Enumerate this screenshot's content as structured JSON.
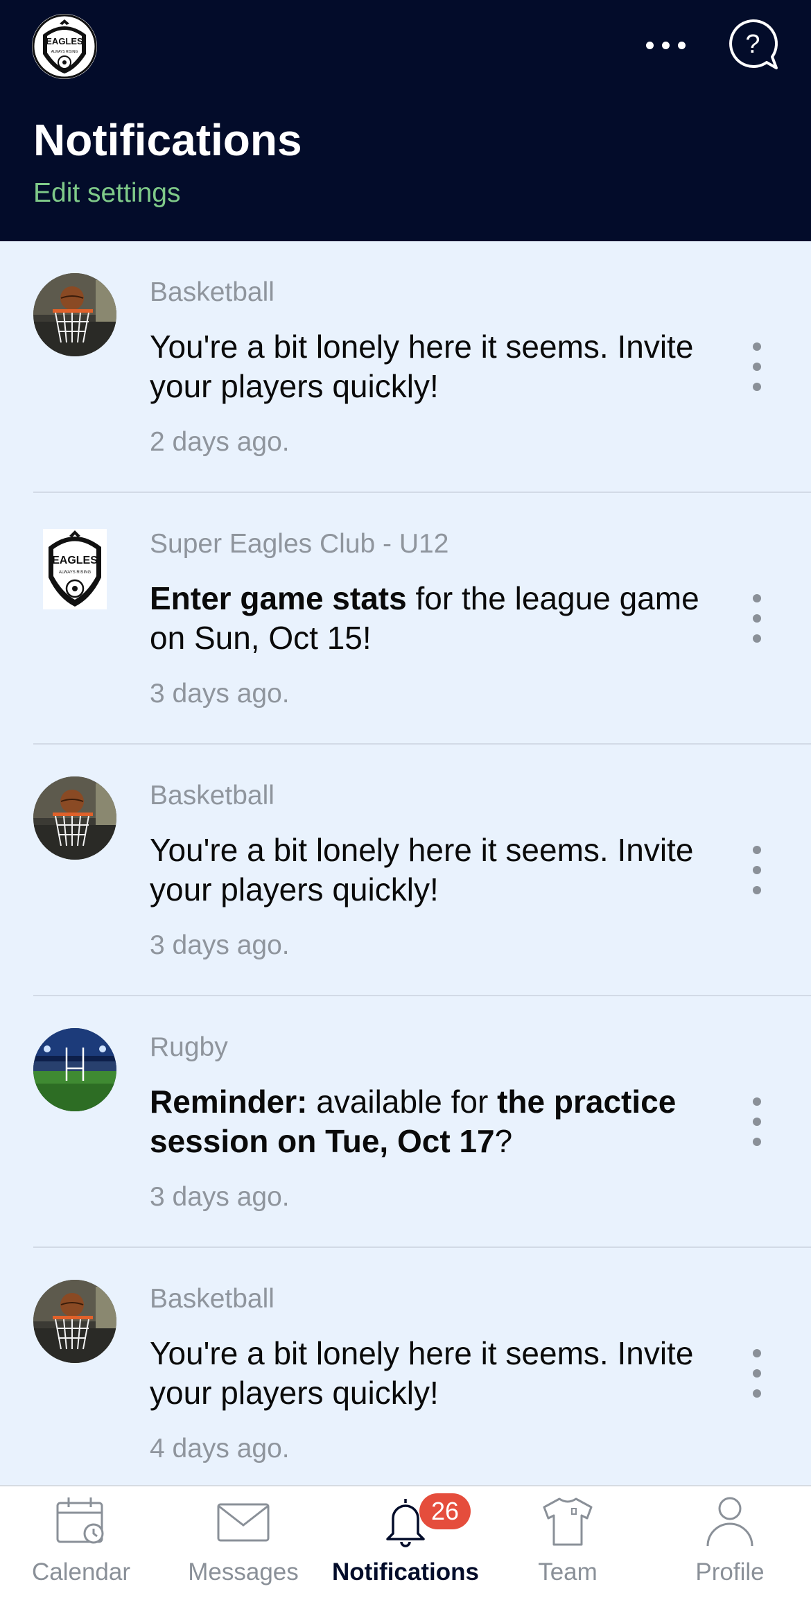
{
  "header": {
    "logo_text": "EAGLES",
    "logo_subtext": "ALWAYS RISING",
    "more_icon": "more-horizontal-icon",
    "help_icon": "help-chat-icon",
    "title": "Notifications",
    "edit_settings_label": "Edit settings"
  },
  "notifications": [
    {
      "avatar": "basketball-hoop-avatar",
      "source": "Basketball",
      "message": "You're a bit lonely here it seems. Invite your players quickly!",
      "time": "2 days ago."
    },
    {
      "avatar": "eagles-club-logo",
      "source": "Super Eagles Club - U12",
      "message_bold_1": "Enter game stats",
      "message_rest_1": " for the league game on Sun, Oct 15!",
      "time": "3 days ago."
    },
    {
      "avatar": "basketball-hoop-avatar",
      "source": "Basketball",
      "message": "You're a bit lonely here it seems. Invite your players quickly!",
      "time": "3 days ago."
    },
    {
      "avatar": "rugby-stadium-avatar",
      "source": "Rugby",
      "message_bold_1": "Reminder:",
      "message_rest_1": " available for ",
      "message_bold_2": "the practice session on Tue, Oct 17",
      "message_rest_2": "?",
      "time": "3 days ago."
    },
    {
      "avatar": "basketball-hoop-avatar",
      "source": "Basketball",
      "message": "You're a bit lonely here it seems. Invite your players quickly!",
      "time": "4 days ago."
    }
  ],
  "tabbar": {
    "tabs": [
      {
        "label": "Calendar",
        "icon": "calendar-icon"
      },
      {
        "label": "Messages",
        "icon": "envelope-icon"
      },
      {
        "label": "Notifications",
        "icon": "bell-icon",
        "badge": "26",
        "active": true
      },
      {
        "label": "Team",
        "icon": "jersey-icon"
      },
      {
        "label": "Profile",
        "icon": "person-icon"
      }
    ]
  },
  "colors": {
    "header_bg": "#030c2a",
    "list_bg": "#e9f2fd",
    "accent_green": "#7fca89",
    "badge_red": "#e54d3c"
  }
}
